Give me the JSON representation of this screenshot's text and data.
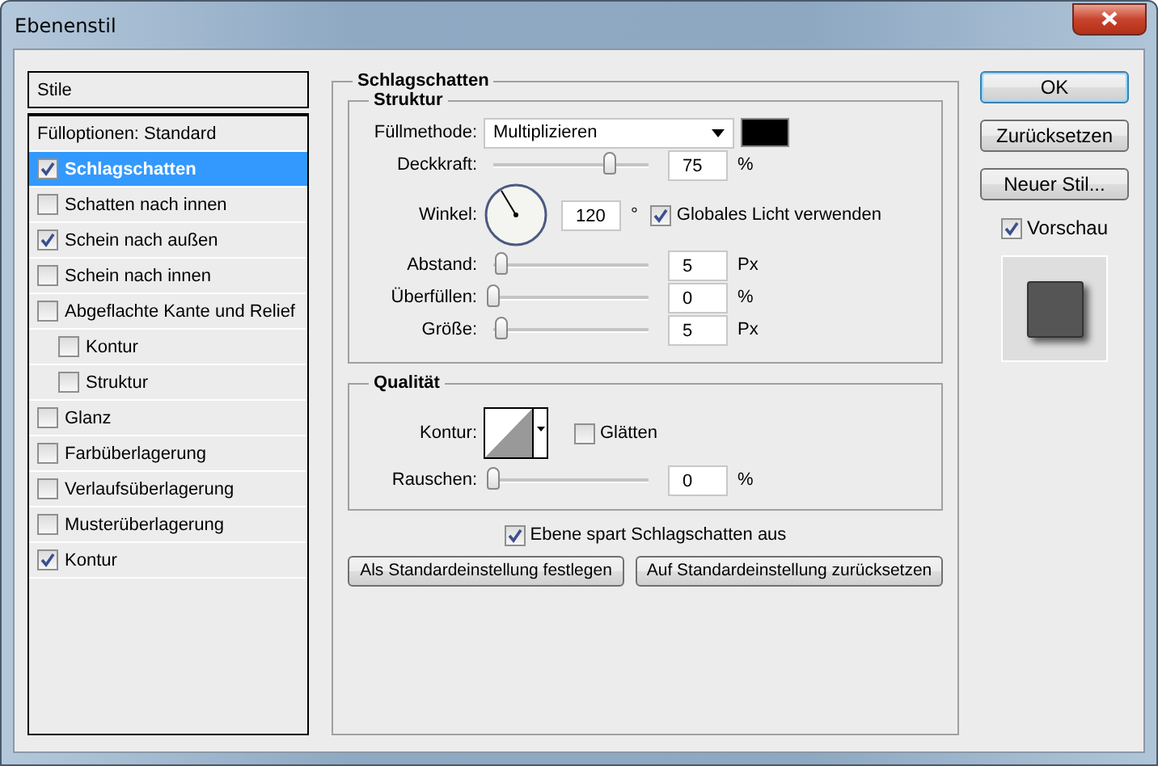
{
  "window": {
    "title": "Ebenenstil"
  },
  "styles_panel": {
    "header": "Stile",
    "items": [
      {
        "label": "Fülloptionen: Standard",
        "kind": "plain",
        "selected": false
      },
      {
        "label": "Schlagschatten",
        "kind": "check",
        "checked": true,
        "selected": true
      },
      {
        "label": "Schatten nach innen",
        "kind": "check",
        "checked": false,
        "selected": false
      },
      {
        "label": "Schein nach außen",
        "kind": "check",
        "checked": true,
        "selected": false
      },
      {
        "label": "Schein nach innen",
        "kind": "check",
        "checked": false,
        "selected": false
      },
      {
        "label": "Abgeflachte Kante und Relief",
        "kind": "check",
        "checked": false,
        "selected": false,
        "children": [
          {
            "label": "Kontur",
            "kind": "check",
            "checked": false,
            "selected": false
          },
          {
            "label": "Struktur",
            "kind": "check",
            "checked": false,
            "selected": false
          }
        ]
      },
      {
        "label": "Glanz",
        "kind": "check",
        "checked": false,
        "selected": false
      },
      {
        "label": "Farbüberlagerung",
        "kind": "check",
        "checked": false,
        "selected": false
      },
      {
        "label": "Verlaufsüberlagerung",
        "kind": "check",
        "checked": false,
        "selected": false
      },
      {
        "label": "Musterüberlagerung",
        "kind": "check",
        "checked": false,
        "selected": false
      },
      {
        "label": "Kontur",
        "kind": "check",
        "checked": true,
        "selected": false
      }
    ]
  },
  "section": {
    "title": "Schlagschatten",
    "groups": [
      {
        "title": "Struktur",
        "rows": [
          {
            "kind": "dropdown",
            "label": "Füllmethode:",
            "value": "Multiplizieren",
            "color": "#000000"
          },
          {
            "kind": "slider",
            "label": "Deckkraft:",
            "level": 0.75,
            "value": "75",
            "unit": "%"
          },
          {
            "kind": "angle",
            "label": "Winkel:",
            "value": "120",
            "unit": "°",
            "option": {
              "label": "Globales Licht verwenden",
              "checked": true
            }
          },
          {
            "kind": "slider",
            "label": "Abstand:",
            "level": 0.05,
            "value": "5",
            "unit": "Px"
          },
          {
            "kind": "slider",
            "label": "Überfüllen:",
            "level": 0,
            "value": "0",
            "unit": "%"
          },
          {
            "kind": "slider",
            "label": "Größe:",
            "level": 0.05,
            "value": "5",
            "unit": "Px"
          }
        ]
      },
      {
        "title": "Qualität",
        "rows": [
          {
            "kind": "contour",
            "label": "Kontur:",
            "option": {
              "label": "Glätten",
              "checked": false
            }
          },
          {
            "kind": "slider",
            "label": "Rauschen:",
            "level": 0,
            "value": "0",
            "unit": "%"
          }
        ]
      }
    ],
    "knockout": {
      "label": "Ebene spart Schlagschatten aus",
      "checked": true
    },
    "buttons": [
      "Als Standardeinstellung festlegen",
      "Auf Standardeinstellung zurücksetzen"
    ]
  },
  "side_buttons": [
    {
      "label": "OK",
      "default": true
    },
    {
      "label": "Zurücksetzen",
      "default": false
    },
    {
      "label": "Neuer Stil...",
      "default": false
    }
  ],
  "preview": {
    "label": "Vorschau",
    "checked": true
  }
}
